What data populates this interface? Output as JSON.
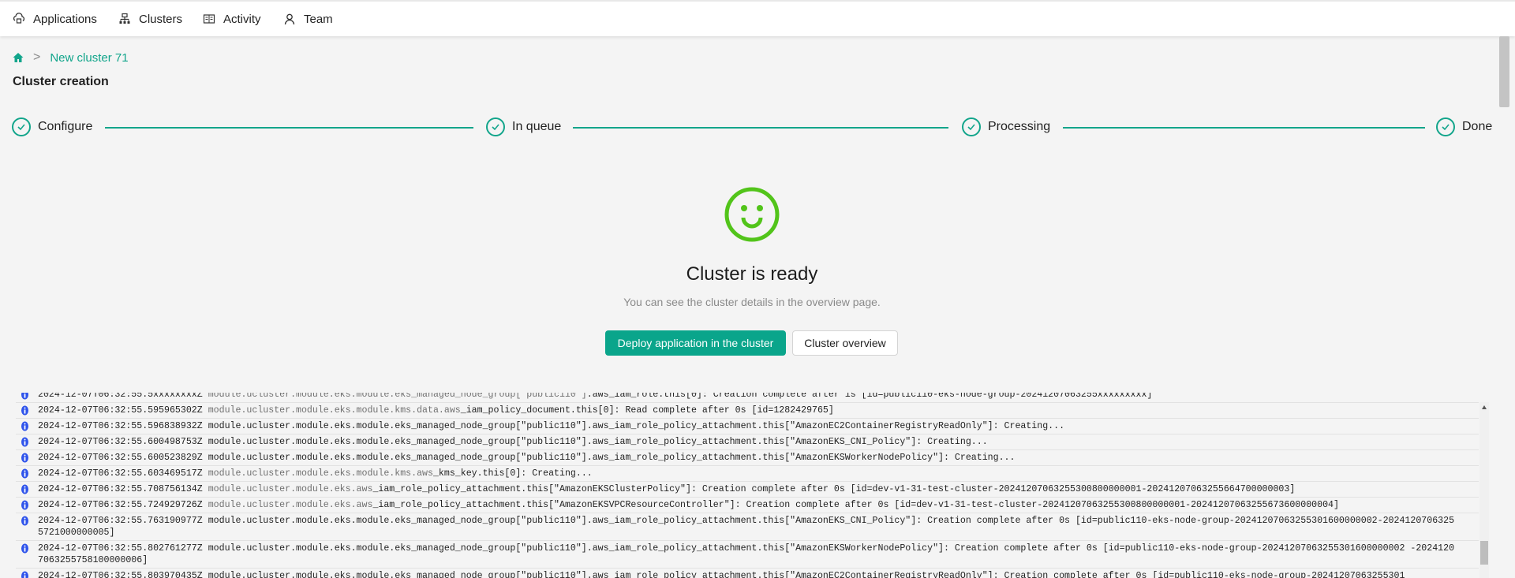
{
  "nav": {
    "items": [
      {
        "label": "Applications",
        "icon": "cloud-app-icon"
      },
      {
        "label": "Clusters",
        "icon": "cluster-icon"
      },
      {
        "label": "Activity",
        "icon": "book-icon"
      },
      {
        "label": "Team",
        "icon": "user-icon"
      }
    ]
  },
  "breadcrumb": {
    "home_icon": "home-icon",
    "current": "New cluster 71"
  },
  "page_title": "Cluster creation",
  "steps": [
    {
      "label": "Configure",
      "status": "done"
    },
    {
      "label": "In queue",
      "status": "done"
    },
    {
      "label": "Processing",
      "status": "done"
    },
    {
      "label": "Done",
      "status": "done"
    }
  ],
  "result": {
    "icon": "smiley-icon",
    "title": "Cluster is ready",
    "subtitle": "You can see the cluster details in the overview page.",
    "primary_button": "Deploy application in the cluster",
    "secondary_button": "Cluster overview"
  },
  "colors": {
    "accent": "#0aa58b",
    "success": "#52c41a",
    "info": "#2f54eb"
  },
  "logs": [
    {
      "ts": "2024-12-07T06:32:55.5xxxxxxxxZ",
      "muted": "module.ucluster.module.eks.module.eks_managed_node_group[\"public110\"]",
      "text": ".aws_iam_role.this[0]: Creation complete after 1s [id=public110-eks-node-group-20241207063255xxxxxxxxx]"
    },
    {
      "ts": "2024-12-07T06:32:55.595965302Z",
      "muted": "module.ucluster.module.eks.module.kms.data.aws",
      "text": "_iam_policy_document.this[0]: Read complete after 0s [id=1282429765]"
    },
    {
      "ts": "2024-12-07T06:32:55.596838932Z",
      "muted": "",
      "text": "module.ucluster.module.eks.module.eks_managed_node_group[\"public110\"].aws_iam_role_policy_attachment.this[\"AmazonEC2ContainerRegistryReadOnly\"]: Creating..."
    },
    {
      "ts": "2024-12-07T06:32:55.600498753Z",
      "muted": "",
      "text": "module.ucluster.module.eks.module.eks_managed_node_group[\"public110\"].aws_iam_role_policy_attachment.this[\"AmazonEKS_CNI_Policy\"]: Creating..."
    },
    {
      "ts": "2024-12-07T06:32:55.600523829Z",
      "muted": "",
      "text": "module.ucluster.module.eks.module.eks_managed_node_group[\"public110\"].aws_iam_role_policy_attachment.this[\"AmazonEKSWorkerNodePolicy\"]: Creating..."
    },
    {
      "ts": "2024-12-07T06:32:55.603469517Z",
      "muted": "module.ucluster.module.eks.module.kms.aws",
      "text": "_kms_key.this[0]: Creating..."
    },
    {
      "ts": "2024-12-07T06:32:55.708756134Z",
      "muted": "module.ucluster.module.eks.aws",
      "text": "_iam_role_policy_attachment.this[\"AmazonEKSClusterPolicy\"]: Creation complete after 0s [id=dev-v1-31-test-cluster-20241207063255300800000001-20241207063255664700000003]"
    },
    {
      "ts": "2024-12-07T06:32:55.724929726Z",
      "muted": "module.ucluster.module.eks.aws",
      "text": "_iam_role_policy_attachment.this[\"AmazonEKSVPCResourceController\"]: Creation complete after 0s [id=dev-v1-31-test-cluster-20241207063255300800000001-20241207063255673600000004]"
    },
    {
      "ts": "2024-12-07T06:32:55.763190977Z",
      "muted": "",
      "text": "module.ucluster.module.eks.module.eks_managed_node_group[\"public110\"].aws_iam_role_policy_attachment.this[\"AmazonEKS_CNI_Policy\"]: Creation complete after 0s [id=public110-eks-node-group-20241207063255301600000002-20241207063255721000000005]"
    },
    {
      "ts": "2024-12-07T06:32:55.802761277Z",
      "muted": "",
      "text": "module.ucluster.module.eks.module.eks_managed_node_group[\"public110\"].aws_iam_role_policy_attachment.this[\"AmazonEKSWorkerNodePolicy\"]: Creation complete after 0s [id=public110-eks-node-group-20241207063255301600000002 -20241207063255758100000006]"
    },
    {
      "ts": "2024-12-07T06:32:55.803970435Z",
      "muted": "",
      "text": "module.ucluster.module.eks.module.eks_managed_node_group[\"public110\"].aws_iam_role_policy_attachment.this[\"AmazonEC2ContainerRegistryReadOnly\"]: Creation complete after 0s [id=public110-eks-node-group-20241207063255301"
    }
  ]
}
